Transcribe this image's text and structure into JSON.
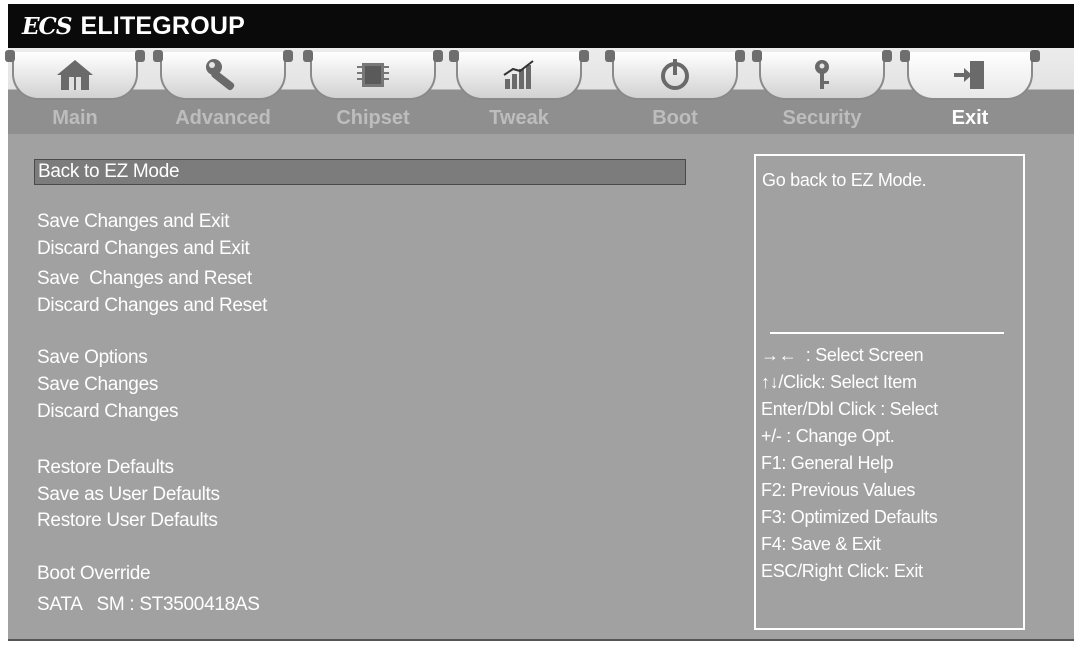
{
  "header": {
    "logo_mark": "ECS",
    "brand": "ELITEGROUP"
  },
  "tabs": [
    {
      "label": "Main",
      "icon": "home-icon",
      "active": false
    },
    {
      "label": "Advanced",
      "icon": "wrench-icon",
      "active": false
    },
    {
      "label": "Chipset",
      "icon": "chip-icon",
      "active": false
    },
    {
      "label": "Tweak",
      "icon": "chart-icon",
      "active": false
    },
    {
      "label": "Boot",
      "icon": "power-icon",
      "active": false
    },
    {
      "label": "Security",
      "icon": "key-icon",
      "active": false
    },
    {
      "label": "Exit",
      "icon": "exit-door-icon",
      "active": true
    }
  ],
  "menu": {
    "back_to_ez": "Back to EZ Mode",
    "save_exit": "Save Changes and Exit",
    "discard_exit": "Discard Changes and Exit",
    "save_reset": "Save  Changes and Reset",
    "discard_reset": "Discard Changes and Reset",
    "save_options": "Save Options",
    "save_changes": "Save Changes",
    "discard_changes": "Discard Changes",
    "restore_defaults": "Restore Defaults",
    "save_user_defaults": "Save as User Defaults",
    "restore_user_defaults": "Restore User Defaults",
    "boot_override": "Boot Override",
    "boot_device": "SATA   SM : ST3500418AS"
  },
  "help": {
    "description": "Go back to EZ Mode.",
    "keys": [
      "→←  : Select Screen",
      "↑↓/Click: Select Item",
      "Enter/Dbl Click : Select",
      "+/- : Change Opt.",
      "F1: General Help",
      "F2: Previous Values",
      "F3: Optimized Defaults",
      "F4: Save & Exit",
      "ESC/Right Click: Exit"
    ]
  },
  "colors": {
    "panel": "#a1a1a1",
    "selected_bar": "#7c7c7c",
    "header": "#0a0a0a",
    "active_tab_text": "#ffffff",
    "inactive_tab_text": "#bdbdbd"
  }
}
